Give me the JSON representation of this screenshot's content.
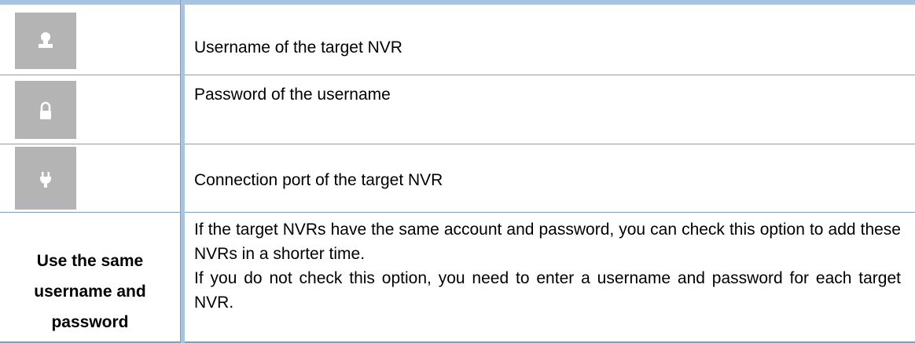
{
  "rows": [
    {
      "icon": "user-icon",
      "text": "Username of the target NVR"
    },
    {
      "icon": "lock-icon",
      "text": "Password of the username"
    },
    {
      "icon": "plug-icon",
      "text": "Connection port of the target NVR"
    }
  ],
  "same_credentials": {
    "label_line1": "Use the same",
    "label_line2": "username and",
    "label_line3": "password",
    "para1": "If the target NVRs have the same account and password, you can check this option to add these NVRs in a shorter time.",
    "para2": "If you do not check this option, you need to enter a username and password for each target NVR."
  },
  "colors": {
    "header_bar": "#a9c3e2",
    "rule": "#7f9fc6",
    "icon_bg": "#b4b4b4",
    "icon_fg": "#ffffff"
  }
}
